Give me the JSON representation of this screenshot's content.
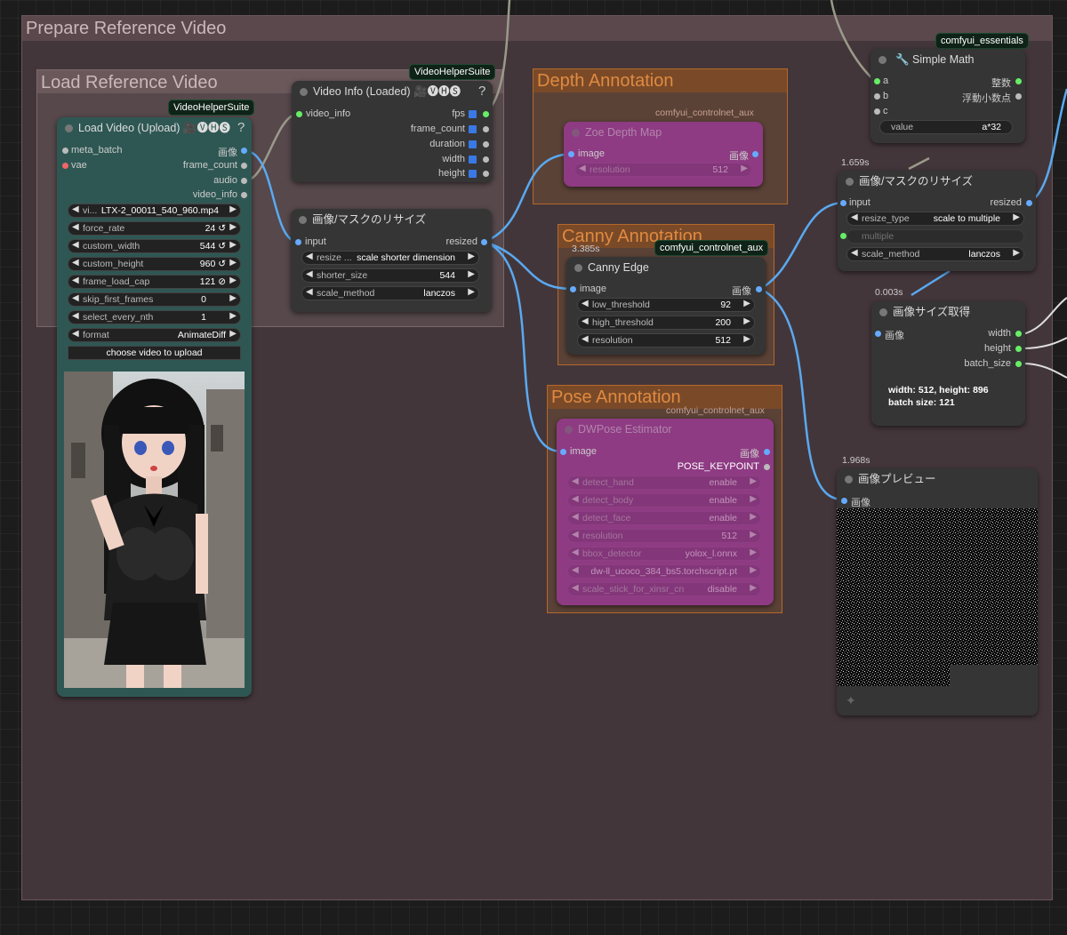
{
  "groups": {
    "prepare": {
      "title": "Prepare Reference Video"
    },
    "load": {
      "title": "Load Reference Video"
    },
    "depth": {
      "title": "Depth Annotation"
    },
    "canny": {
      "title": "Canny Annotation"
    },
    "pose": {
      "title": "Pose Annotation"
    }
  },
  "badges": {
    "vhs1": "VideoHelperSuite",
    "vhs2": "VideoHelperSuite",
    "essentials": "comfyui_essentials",
    "aux_depth": "comfyui_controlnet_aux",
    "aux_canny": "comfyui_controlnet_aux",
    "aux_pose": "comfyui_controlnet_aux"
  },
  "load_video": {
    "title": "Load Video (Upload) 🎥🅥🅗🅢",
    "help": "?",
    "inputs": [
      "meta_batch",
      "vae"
    ],
    "outputs": [
      "画像",
      "frame_count",
      "audio",
      "video_info"
    ],
    "widgets": [
      {
        "label": "vi...",
        "value": "LTX-2_00011_540_960.mp4"
      },
      {
        "label": "force_rate",
        "value": "24 ↺"
      },
      {
        "label": "custom_width",
        "value": "544 ↺"
      },
      {
        "label": "custom_height",
        "value": "960 ↺"
      },
      {
        "label": "frame_load_cap",
        "value": "121 ⊘"
      },
      {
        "label": "skip_first_frames",
        "value": "0"
      },
      {
        "label": "select_every_nth",
        "value": "1"
      },
      {
        "label": "format",
        "value": "AnimateDiff"
      }
    ],
    "upload_button": "choose video to upload"
  },
  "video_info": {
    "title": "Video Info (Loaded) 🎥🅥🅗🅢",
    "help": "?",
    "inputs": [
      "video_info"
    ],
    "outputs": [
      "fps",
      "frame_count",
      "duration",
      "width",
      "height"
    ]
  },
  "resize1": {
    "title": "画像/マスクのリサイズ",
    "input": "input",
    "output": "resized",
    "widgets": [
      {
        "label": "resize ...",
        "value": "scale shorter dimension"
      },
      {
        "label": "shorter_size",
        "value": "544"
      },
      {
        "label": "scale_method",
        "value": "lanczos"
      }
    ]
  },
  "zoe": {
    "title": "Zoe Depth Map",
    "input": "image",
    "output": "画像",
    "widgets": [
      {
        "label": "resolution",
        "value": "512"
      }
    ]
  },
  "canny": {
    "timing": "3.385s",
    "title": "Canny Edge",
    "input": "image",
    "output": "画像",
    "widgets": [
      {
        "label": "low_threshold",
        "value": "92"
      },
      {
        "label": "high_threshold",
        "value": "200"
      },
      {
        "label": "resolution",
        "value": "512"
      }
    ]
  },
  "dwpose": {
    "title": "DWPose Estimator",
    "input": "image",
    "outputs": [
      "画像",
      "POSE_KEYPOINT"
    ],
    "widgets": [
      {
        "label": "detect_hand",
        "value": "enable"
      },
      {
        "label": "detect_body",
        "value": "enable"
      },
      {
        "label": "detect_face",
        "value": "enable"
      },
      {
        "label": "resolution",
        "value": "512"
      },
      {
        "label": "bbox_detector",
        "value": "yolox_l.onnx"
      },
      {
        "label": "",
        "value": "dw-ll_ucoco_384_bs5.torchscript.pt"
      },
      {
        "label": "scale_stick_for_xinsr_cn",
        "value": "disable"
      }
    ]
  },
  "simple_math": {
    "title": "🔧 Simple Math",
    "inputs": [
      "a",
      "b",
      "c"
    ],
    "outputs": [
      "整数",
      "浮動小数点"
    ],
    "widget": {
      "label": "value",
      "value": "a*32"
    }
  },
  "resize2": {
    "timing": "1.659s",
    "title": "画像/マスクのリサイズ",
    "input": "input",
    "output": "resized",
    "widgets": [
      {
        "label": "resize_type",
        "value": "scale to multiple"
      },
      {
        "label": "multiple",
        "value": ""
      },
      {
        "label": "scale_method",
        "value": "lanczos"
      }
    ]
  },
  "image_size": {
    "timing": "0.003s",
    "title": "画像サイズ取得",
    "input": "画像",
    "outputs": [
      "width",
      "height",
      "batch_size"
    ],
    "info_line1": "width: 512, height: 896",
    "info_line2": "batch size: 121"
  },
  "preview": {
    "timing": "1.968s",
    "title": "画像プレビュー",
    "input": "画像"
  },
  "colors": {
    "group_prepare": "#4a3c3f",
    "group_load": "#5a4a4d",
    "group_orange": "#a0581f",
    "node_teal": "#2f5b57",
    "node_magenta": "#9b3e8e",
    "link_blue": "#5aa9f0",
    "link_gray": "#9a9a8a"
  }
}
